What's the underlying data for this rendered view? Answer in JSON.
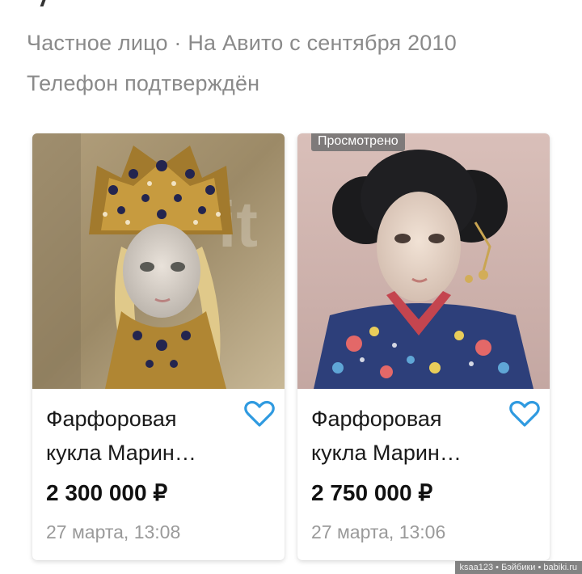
{
  "seller": {
    "line1": "Частное лицо · На Авито с сентября 2010",
    "line2": "Телефон подтверждён"
  },
  "listings": [
    {
      "title_line1": "Фарфоровая",
      "title_line2": "кукла Марин…",
      "price": "2 300 000 ₽",
      "date": "27 марта, 13:08",
      "badge": "",
      "favorite_icon": "heart-outline-icon"
    },
    {
      "title_line1": "Фарфоровая",
      "title_line2": "кукла Марин…",
      "price": "2 750 000 ₽",
      "date": "27 марта, 13:06",
      "badge": "Просмотрено",
      "favorite_icon": "heart-outline-icon"
    }
  ],
  "watermark": "ksaa123 • Бэйбики • babiki.ru",
  "colors": {
    "heart": "#2f9ae0",
    "muted_text": "#8a8a8a",
    "badge_bg": "#6e6e6e"
  }
}
